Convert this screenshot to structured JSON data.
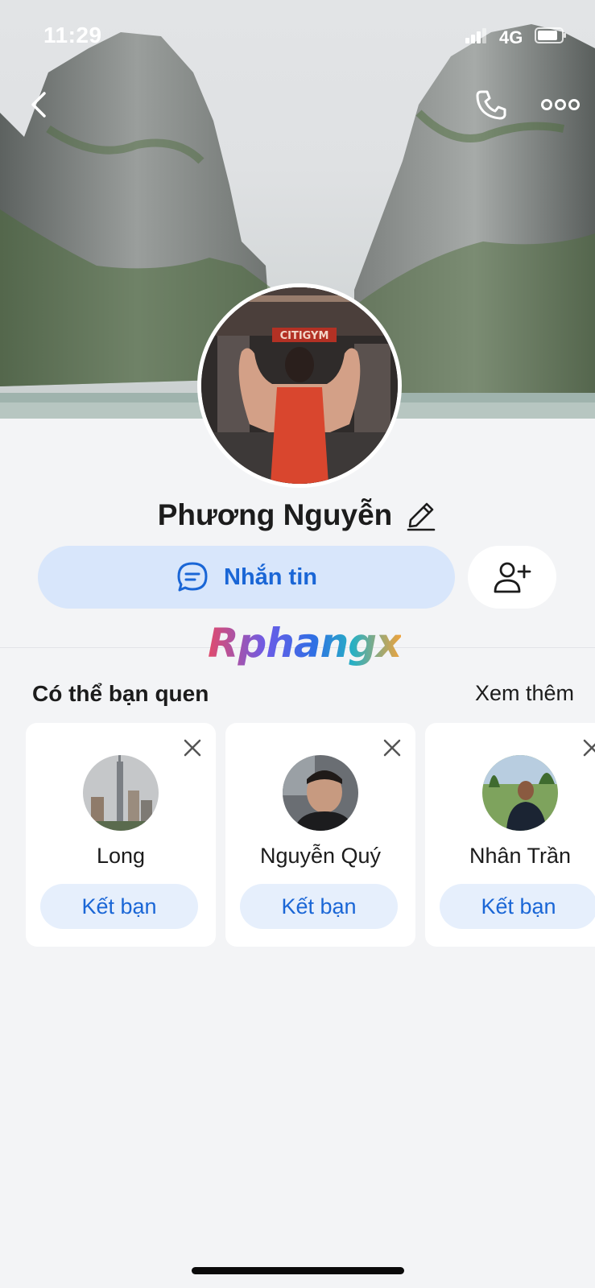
{
  "status_bar": {
    "time": "11:29",
    "network": "4G"
  },
  "profile": {
    "name": "Phương Nguyễn",
    "cover_icon": "limestone-cliffs",
    "avatar_icon": "gym-photo",
    "avatar_text": "CITIGYM"
  },
  "actions": {
    "message_label": "Nhắn tin",
    "add_friend_icon": "add-user-icon"
  },
  "watermark": "Rphangx",
  "suggestions": {
    "title": "Có thể bạn quen",
    "see_more": "Xem thêm",
    "items": [
      {
        "name": "Long",
        "button": "Kết bạn"
      },
      {
        "name": "Nguyễn Quý",
        "button": "Kết bạn"
      },
      {
        "name": "Nhân Trần",
        "button": "Kết bạn"
      }
    ]
  },
  "colors": {
    "accent": "#1a66d6",
    "button_bg": "#d8e6fb",
    "page_bg": "#f3f4f6"
  }
}
